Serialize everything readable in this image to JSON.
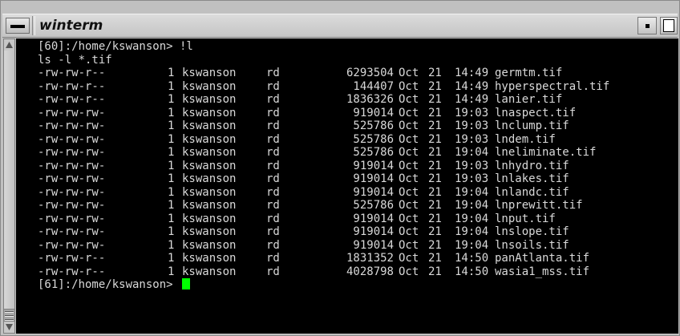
{
  "window": {
    "title": "winterm"
  },
  "terminal": {
    "lines": [
      "[60]:/home/kswanson> !l",
      "ls -l *.tif"
    ],
    "files": [
      {
        "perm": "-rw-rw-r--",
        "links": "1",
        "owner": "kswanson",
        "group": "rd",
        "size": "6293504",
        "month": "Oct",
        "day": "21",
        "time": "14:49",
        "name": "germtm.tif"
      },
      {
        "perm": "-rw-rw-r--",
        "links": "1",
        "owner": "kswanson",
        "group": "rd",
        "size": "144407",
        "month": "Oct",
        "day": "21",
        "time": "14:49",
        "name": "hyperspectral.tif"
      },
      {
        "perm": "-rw-rw-r--",
        "links": "1",
        "owner": "kswanson",
        "group": "rd",
        "size": "1836326",
        "month": "Oct",
        "day": "21",
        "time": "14:49",
        "name": "lanier.tif"
      },
      {
        "perm": "-rw-rw-rw-",
        "links": "1",
        "owner": "kswanson",
        "group": "rd",
        "size": "919014",
        "month": "Oct",
        "day": "21",
        "time": "19:03",
        "name": "lnaspect.tif"
      },
      {
        "perm": "-rw-rw-rw-",
        "links": "1",
        "owner": "kswanson",
        "group": "rd",
        "size": "525786",
        "month": "Oct",
        "day": "21",
        "time": "19:03",
        "name": "lnclump.tif"
      },
      {
        "perm": "-rw-rw-rw-",
        "links": "1",
        "owner": "kswanson",
        "group": "rd",
        "size": "525786",
        "month": "Oct",
        "day": "21",
        "time": "19:03",
        "name": "lndem.tif"
      },
      {
        "perm": "-rw-rw-rw-",
        "links": "1",
        "owner": "kswanson",
        "group": "rd",
        "size": "525786",
        "month": "Oct",
        "day": "21",
        "time": "19:04",
        "name": "lneliminate.tif"
      },
      {
        "perm": "-rw-rw-rw-",
        "links": "1",
        "owner": "kswanson",
        "group": "rd",
        "size": "919014",
        "month": "Oct",
        "day": "21",
        "time": "19:03",
        "name": "lnhydro.tif"
      },
      {
        "perm": "-rw-rw-rw-",
        "links": "1",
        "owner": "kswanson",
        "group": "rd",
        "size": "919014",
        "month": "Oct",
        "day": "21",
        "time": "19:03",
        "name": "lnlakes.tif"
      },
      {
        "perm": "-rw-rw-rw-",
        "links": "1",
        "owner": "kswanson",
        "group": "rd",
        "size": "919014",
        "month": "Oct",
        "day": "21",
        "time": "19:04",
        "name": "lnlandc.tif"
      },
      {
        "perm": "-rw-rw-rw-",
        "links": "1",
        "owner": "kswanson",
        "group": "rd",
        "size": "525786",
        "month": "Oct",
        "day": "21",
        "time": "19:04",
        "name": "lnprewitt.tif"
      },
      {
        "perm": "-rw-rw-rw-",
        "links": "1",
        "owner": "kswanson",
        "group": "rd",
        "size": "919014",
        "month": "Oct",
        "day": "21",
        "time": "19:04",
        "name": "lnput.tif"
      },
      {
        "perm": "-rw-rw-rw-",
        "links": "1",
        "owner": "kswanson",
        "group": "rd",
        "size": "919014",
        "month": "Oct",
        "day": "21",
        "time": "19:04",
        "name": "lnslope.tif"
      },
      {
        "perm": "-rw-rw-rw-",
        "links": "1",
        "owner": "kswanson",
        "group": "rd",
        "size": "919014",
        "month": "Oct",
        "day": "21",
        "time": "19:04",
        "name": "lnsoils.tif"
      },
      {
        "perm": "-rw-rw-r--",
        "links": "1",
        "owner": "kswanson",
        "group": "rd",
        "size": "1831352",
        "month": "Oct",
        "day": "21",
        "time": "14:50",
        "name": "panAtlanta.tif"
      },
      {
        "perm": "-rw-rw-r--",
        "links": "1",
        "owner": "kswanson",
        "group": "rd",
        "size": "4028798",
        "month": "Oct",
        "day": "21",
        "time": "14:50",
        "name": "wasia1_mss.tif"
      }
    ],
    "prompt": "[61]:/home/kswanson> ",
    "cursor_color": "#00ff00",
    "text_color": "#d9d9d9",
    "background_color": "#000000"
  },
  "icons": {
    "window_menu": "window-menu-icon",
    "minimize": "minimize-icon",
    "maximize": "maximize-icon",
    "scroll_up": "arrow-up-icon",
    "scroll_down": "arrow-down-icon"
  }
}
